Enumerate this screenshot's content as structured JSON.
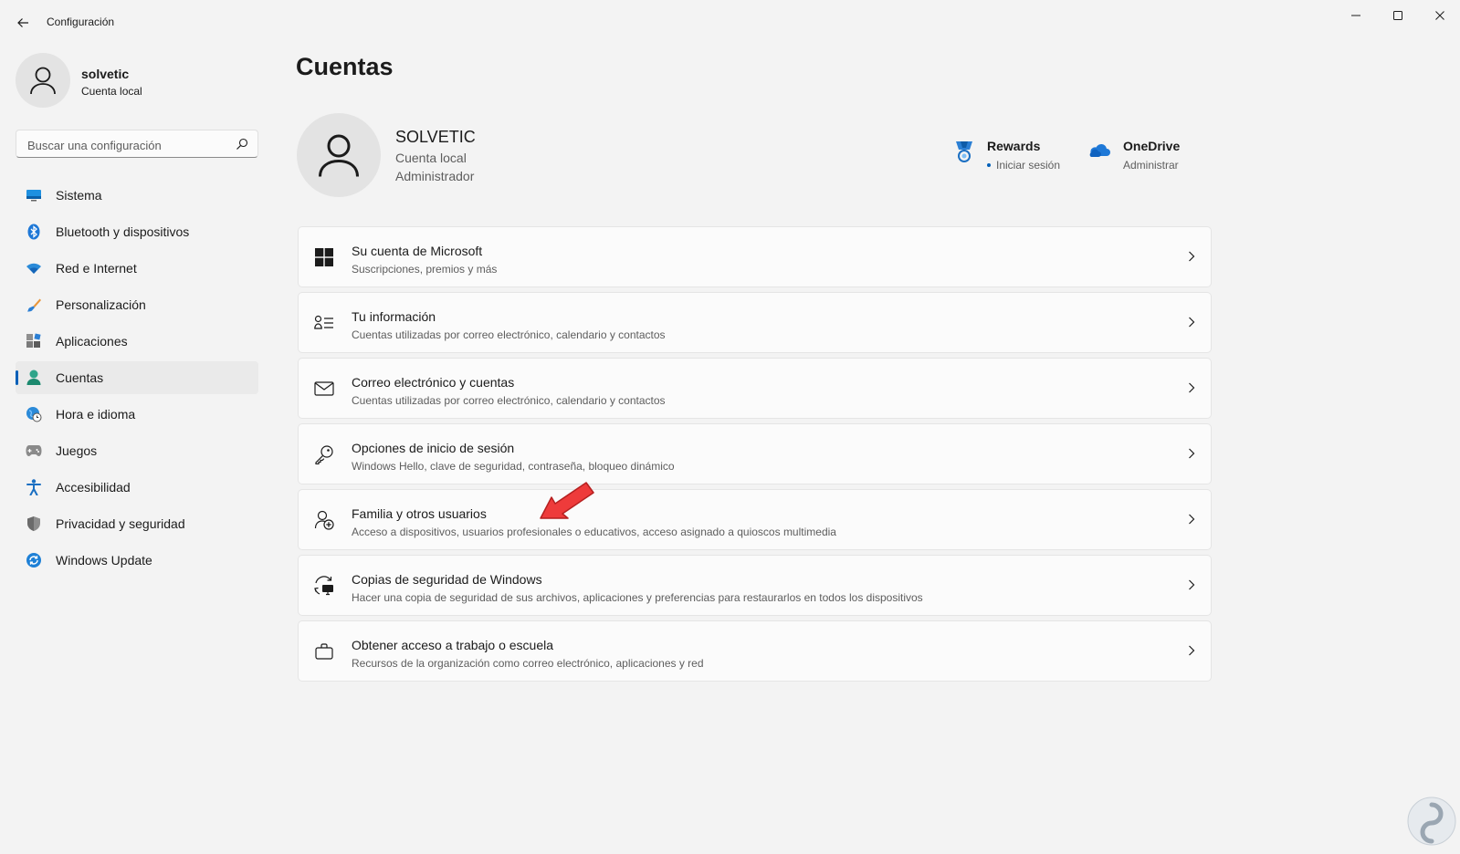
{
  "window": {
    "title": "Configuración"
  },
  "user": {
    "name": "solvetic",
    "type": "Cuenta local"
  },
  "search": {
    "placeholder": "Buscar una configuración"
  },
  "nav": [
    {
      "label": "Sistema",
      "icon": "monitor-icon"
    },
    {
      "label": "Bluetooth y dispositivos",
      "icon": "bluetooth-icon"
    },
    {
      "label": "Red e Internet",
      "icon": "wifi-icon"
    },
    {
      "label": "Personalización",
      "icon": "brush-icon"
    },
    {
      "label": "Aplicaciones",
      "icon": "apps-icon"
    },
    {
      "label": "Cuentas",
      "icon": "person-icon",
      "active": true
    },
    {
      "label": "Hora e idioma",
      "icon": "globe-clock-icon"
    },
    {
      "label": "Juegos",
      "icon": "gamepad-icon"
    },
    {
      "label": "Accesibilidad",
      "icon": "accessibility-icon"
    },
    {
      "label": "Privacidad y seguridad",
      "icon": "shield-icon"
    },
    {
      "label": "Windows Update",
      "icon": "update-icon"
    }
  ],
  "page": {
    "title": "Cuentas",
    "account": {
      "name": "SOLVETIC",
      "type": "Cuenta local",
      "role": "Administrador"
    },
    "rewards": {
      "label": "Rewards",
      "sub": "Iniciar sesión"
    },
    "onedrive": {
      "label": "OneDrive",
      "sub": "Administrar"
    },
    "cards": [
      {
        "title": "Su cuenta de Microsoft",
        "sub": "Suscripciones, premios y más",
        "icon": "windows-logo-icon"
      },
      {
        "title": "Tu información",
        "sub": "Cuentas utilizadas por correo electrónico, calendario y contactos",
        "icon": "contact-card-icon"
      },
      {
        "title": "Correo electrónico y cuentas",
        "sub": "Cuentas utilizadas por correo electrónico, calendario y contactos",
        "icon": "mail-icon"
      },
      {
        "title": "Opciones de inicio de sesión",
        "sub": "Windows Hello, clave de seguridad, contraseña, bloqueo dinámico",
        "icon": "key-icon"
      },
      {
        "title": "Familia y otros usuarios",
        "sub": "Acceso a dispositivos, usuarios profesionales o educativos, acceso asignado a quioscos multimedia",
        "icon": "person-add-icon"
      },
      {
        "title": "Copias de seguridad de Windows",
        "sub": "Hacer una copia de seguridad de sus archivos, aplicaciones y preferencias para restaurarlos en todos los dispositivos",
        "icon": "backup-icon"
      },
      {
        "title": "Obtener acceso a trabajo o escuela",
        "sub": "Recursos de la organización como correo electrónico, aplicaciones y red",
        "icon": "briefcase-icon"
      }
    ]
  },
  "colors": {
    "accent": "#005fb8",
    "background": "#f3f3f3",
    "card": "#fbfbfb",
    "annotation_arrow": "#ee3b3b"
  }
}
